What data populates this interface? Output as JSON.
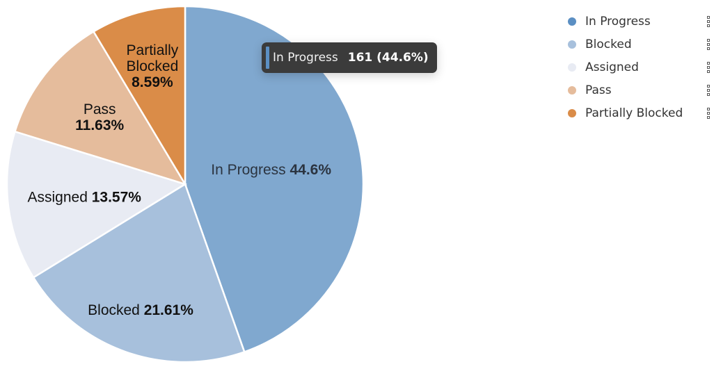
{
  "chart_data": {
    "type": "pie",
    "title": "",
    "start_angle": "12 o'clock, clockwise",
    "slices": [
      {
        "name": "In Progress",
        "percent": 44.6,
        "color": "#80a8cf",
        "legend_color": "#5b8fc3",
        "label_style": "dark",
        "label_lines": [
          [
            "In Progress",
            "44.6%"
          ]
        ]
      },
      {
        "name": "Blocked",
        "percent": 21.61,
        "color": "#a7c0dc",
        "legend_color": "#a7c0dc",
        "label_style": "normal",
        "label_lines": [
          [
            "Blocked",
            "21.61%"
          ]
        ]
      },
      {
        "name": "Assigned",
        "percent": 13.57,
        "color": "#e8ebf3",
        "legend_color": "#e8ebf3",
        "label_style": "normal",
        "label_lines": [
          [
            "Assigned",
            "13.57%"
          ]
        ]
      },
      {
        "name": "Pass",
        "percent": 11.63,
        "color": "#e5bc9c",
        "legend_color": "#e5bc9c",
        "label_style": "normal",
        "label_lines": [
          [
            "Pass",
            ""
          ],
          [
            "",
            "11.63%"
          ]
        ]
      },
      {
        "name": "Partially Blocked",
        "percent": 8.59,
        "color": "#da8c48",
        "legend_color": "#da8c48",
        "label_style": "normal",
        "label_lines": [
          [
            "Partially",
            ""
          ],
          [
            "Blocked",
            ""
          ],
          [
            "",
            "8.59%"
          ]
        ]
      }
    ],
    "legend": {
      "placement": "top-right"
    }
  },
  "legend": {
    "items": [
      {
        "label": "In Progress",
        "color": "#5b8fc3"
      },
      {
        "label": "Blocked",
        "color": "#a7c0dc"
      },
      {
        "label": "Assigned",
        "color": "#e8ebf3"
      },
      {
        "label": "Pass",
        "color": "#e5bc9c"
      },
      {
        "label": "Partially Blocked",
        "color": "#da8c48"
      }
    ]
  },
  "tooltip": {
    "label": "In Progress",
    "value": "161 (44.6%)",
    "color": "#5b8fc3"
  }
}
